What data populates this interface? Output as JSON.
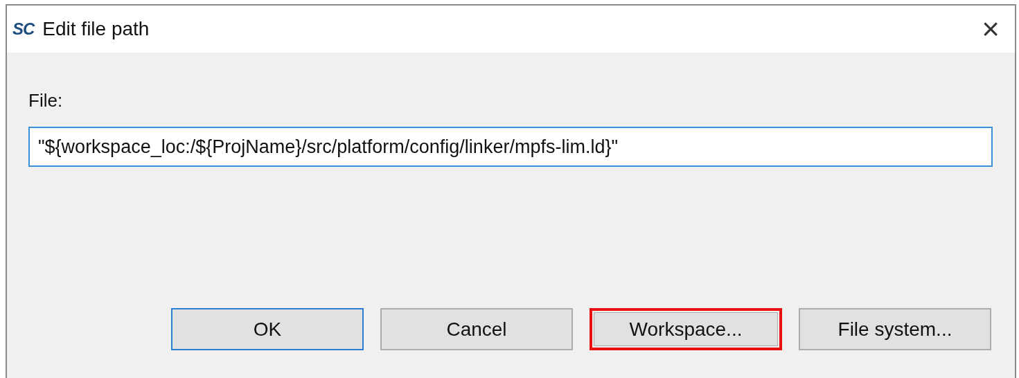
{
  "window": {
    "title": "Edit file path",
    "logo": "SC",
    "close": "×"
  },
  "field": {
    "label": "File:",
    "value": "\"${workspace_loc:/${ProjName}/src/platform/config/linker/mpfs-lim.ld}\"",
    "focused": true
  },
  "buttons": [
    {
      "label": "OK",
      "default": true,
      "highlighted": false
    },
    {
      "label": "Cancel",
      "default": false,
      "highlighted": false
    },
    {
      "label": "Workspace...",
      "default": false,
      "highlighted": true
    },
    {
      "label": "File system...",
      "default": false,
      "highlighted": false
    }
  ]
}
